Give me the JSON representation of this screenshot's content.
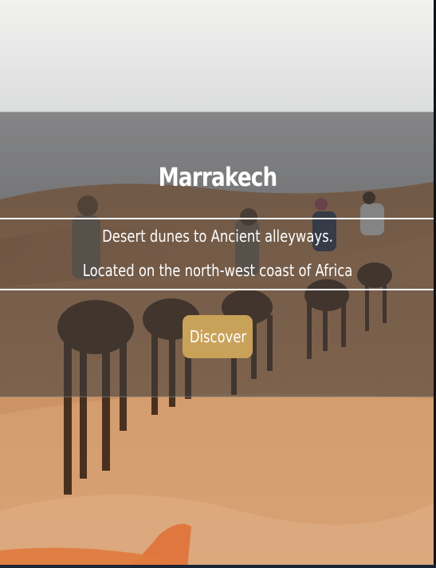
{
  "hero": {
    "title": "Marrakech",
    "tagline_line1": "Desert dunes to Ancient alleyways.",
    "tagline_line2": "Located on the north-west coast of Africa",
    "cta_label": "Discover",
    "image": "desert-camel-caravan-photo"
  },
  "colors": {
    "cta_background": "#c9a25a",
    "overlay": "#3c3c3e",
    "sand": "#c48a55",
    "sky": "#e4e4e2"
  }
}
